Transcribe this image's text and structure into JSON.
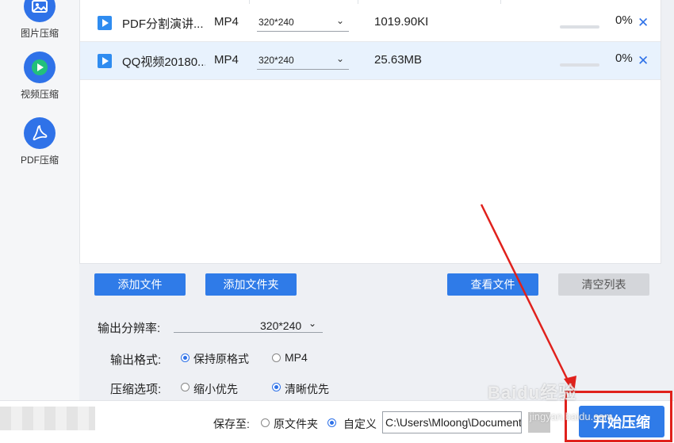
{
  "sidebar": {
    "items": [
      {
        "label": "图片压缩",
        "icon": "image-icon"
      },
      {
        "label": "视频压缩",
        "icon": "play-circle-icon"
      },
      {
        "label": "PDF压缩",
        "icon": "pdf-icon"
      }
    ]
  },
  "files": [
    {
      "name": "PDF分割演讲...",
      "format": "MP4",
      "resolution": "320*240",
      "size": "1019.90KB",
      "progress": 0,
      "percent": "0%",
      "selected": false
    },
    {
      "name": "QQ视频20180...",
      "format": "MP4",
      "resolution": "320*240",
      "size": "25.63MB",
      "progress": 0,
      "percent": "0%",
      "selected": true
    }
  ],
  "actions": {
    "add_file": "添加文件",
    "add_folder": "添加文件夹",
    "view_file": "查看文件",
    "clear_list": "清空列表"
  },
  "options": {
    "resolution_label": "输出分辨率:",
    "resolution_value": "320*240",
    "format_label": "输出格式:",
    "format_keep": "保持原格式",
    "format_mp4": "MP4",
    "compress_label": "压缩选项:",
    "compress_small": "缩小优先",
    "compress_clear": "清晰优先"
  },
  "save": {
    "label": "保存至:",
    "original_folder": "原文件夹",
    "custom": "自定义",
    "path": "C:\\Users\\Mloong\\Documents"
  },
  "start_button": "开始压缩",
  "watermark": "Baidu经验",
  "watermark_sub": "jingyan.baidu.com",
  "colors": {
    "accent": "#2f7be8",
    "highlight_box": "#e0211c",
    "selected_row": "#e8f2fd"
  }
}
